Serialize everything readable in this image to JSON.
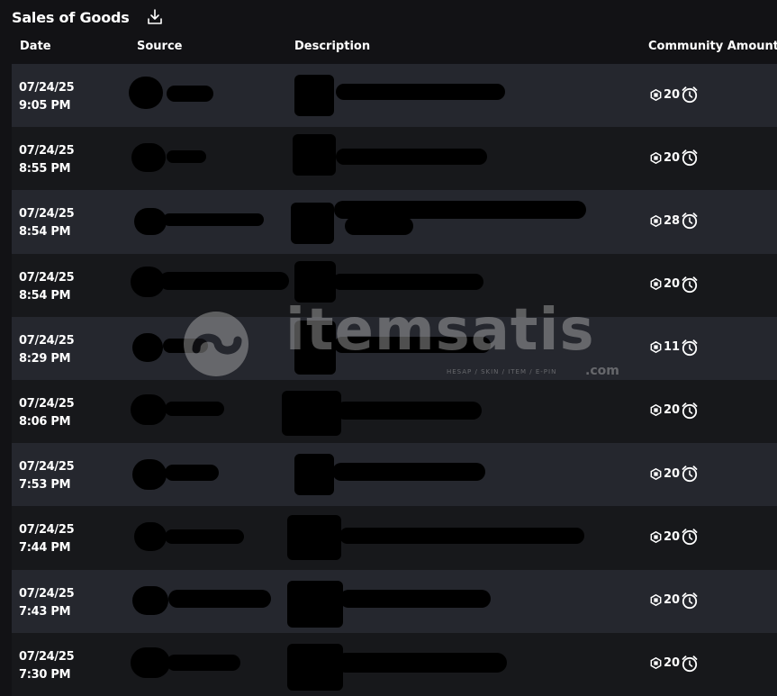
{
  "header": {
    "title": "Sales of Goods"
  },
  "columns": {
    "date": "Date",
    "source": "Source",
    "description": "Description",
    "amount": "Community Amount"
  },
  "rows": [
    {
      "date": "07/24/25",
      "time": "9:05 PM",
      "amount": "20"
    },
    {
      "date": "07/24/25",
      "time": "8:55 PM",
      "amount": "20"
    },
    {
      "date": "07/24/25",
      "time": "8:54 PM",
      "amount": "28"
    },
    {
      "date": "07/24/25",
      "time": "8:54 PM",
      "amount": "20"
    },
    {
      "date": "07/24/25",
      "time": "8:29 PM",
      "amount": "11"
    },
    {
      "date": "07/24/25",
      "time": "8:06 PM",
      "amount": "20"
    },
    {
      "date": "07/24/25",
      "time": "7:53 PM",
      "amount": "20"
    },
    {
      "date": "07/24/25",
      "time": "7:44 PM",
      "amount": "20"
    },
    {
      "date": "07/24/25",
      "time": "7:43 PM",
      "amount": "20"
    },
    {
      "date": "07/24/25",
      "time": "7:30 PM",
      "amount": "20"
    }
  ],
  "watermark": {
    "brand": "itemsatis",
    "tagline": "HESAP / SKIN / ITEM / E-PIN",
    "domain": ".com"
  },
  "icons": {
    "download": "download-icon",
    "currency": "robux-icon",
    "pending": "alarm-clock-icon",
    "info": "info-icon"
  },
  "colors": {
    "row_odd": "#25272e",
    "row_even": "#17181b",
    "background": "#121215"
  }
}
